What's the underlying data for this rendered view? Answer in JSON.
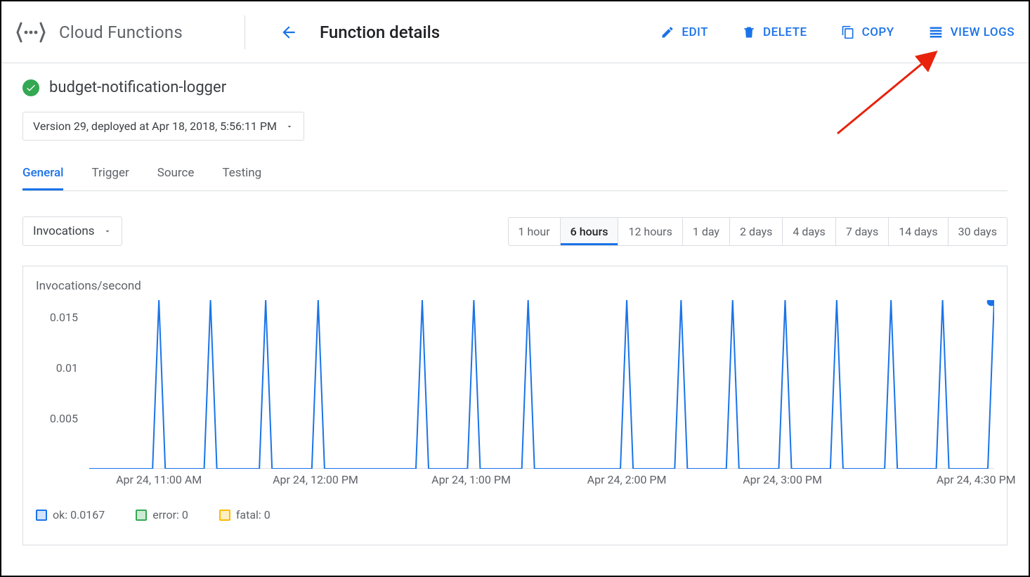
{
  "toolbar": {
    "product_title": "Cloud Functions",
    "page_title": "Function details",
    "actions": {
      "edit": "EDIT",
      "delete": "DELETE",
      "copy": "COPY",
      "view_logs": "VIEW LOGS"
    }
  },
  "function": {
    "name": "budget-notification-logger",
    "status": "ok",
    "version_label": "Version 29, deployed at Apr 18, 2018, 5:56:11 PM"
  },
  "tabs": [
    "General",
    "Trigger",
    "Source",
    "Testing"
  ],
  "active_tab": 0,
  "metric_label": "Invocations",
  "range_options": [
    "1 hour",
    "6 hours",
    "12 hours",
    "1 day",
    "2 days",
    "4 days",
    "7 days",
    "14 days",
    "30 days"
  ],
  "range_active": 1,
  "chart_title": "Invocations/second",
  "legend": [
    {
      "color_border": "#1a73e8",
      "color_fill": "#d2e3fc",
      "label": "ok: 0.0167"
    },
    {
      "color_border": "#34a853",
      "color_fill": "#ceead6",
      "label": "error: 0"
    },
    {
      "color_border": "#fbbc04",
      "color_fill": "#feefc3",
      "label": "fatal: 0"
    }
  ],
  "chart_data": {
    "type": "line",
    "ylabel": "Invocations/second",
    "ylim": [
      0,
      0.0167
    ],
    "yticks": [
      0.005,
      0.01,
      0.015
    ],
    "xlabel": "",
    "x_ticks": [
      {
        "pos": 7.7,
        "label": "Apr 24, 11:00 AM"
      },
      {
        "pos": 25.0,
        "label": "Apr 24, 12:00 PM"
      },
      {
        "pos": 42.2,
        "label": "Apr 24, 1:00 PM"
      },
      {
        "pos": 59.4,
        "label": "Apr 24, 2:00 PM"
      },
      {
        "pos": 76.6,
        "label": "Apr 24, 3:00 PM"
      },
      {
        "pos": 98.0,
        "label": "Apr 24, 4:30 PM"
      }
    ],
    "series": [
      {
        "name": "ok",
        "color": "#1a73e8",
        "value_peak": 0.0167,
        "spike_positions_pct": [
          7.7,
          13.4,
          19.5,
          25.3,
          36.8,
          42.5,
          48.5,
          59.4,
          65.4,
          71.1,
          76.9,
          82.6,
          88.6,
          94.3,
          100.0
        ]
      },
      {
        "name": "error",
        "color": "#34a853",
        "values_constant": 0
      },
      {
        "name": "fatal",
        "color": "#fbbc04",
        "values_constant": 0
      }
    ],
    "highlight_point": {
      "series": "ok",
      "pos_pct": 100.0,
      "value": 0.0167
    }
  }
}
